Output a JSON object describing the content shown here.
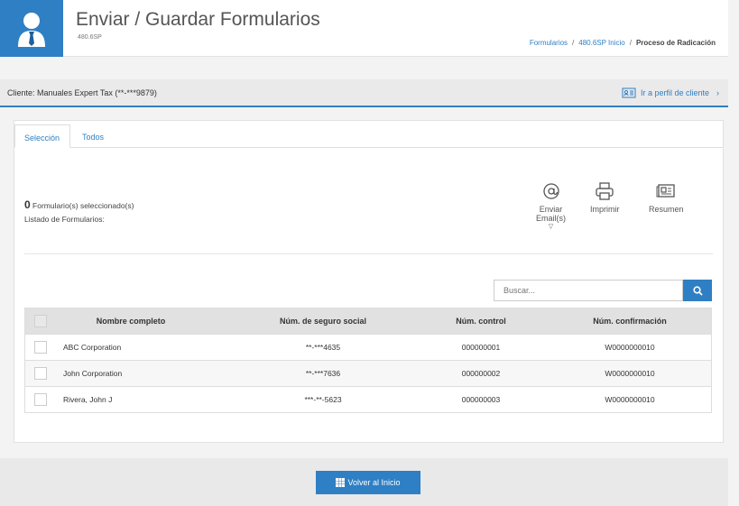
{
  "header": {
    "title": "Enviar / Guardar Formularios",
    "subtitle": "480.6SP",
    "breadcrumb": {
      "item1": "Formularios",
      "sep": "/",
      "item2": "480.6SP Inicio",
      "item3": "Proceso de Radicación"
    }
  },
  "client": {
    "label": "Cliente: Manuales Expert Tax (**-***9879)",
    "profile_link": "Ir a perfil de cliente"
  },
  "tabs": [
    {
      "label": "Selección",
      "active": true
    },
    {
      "label": "Todos",
      "active": false
    }
  ],
  "selection": {
    "count": "0",
    "count_label": " Formulario(s) seleccionado(s)",
    "list_label": "Listado de Formularios:"
  },
  "actions": {
    "email_line1": "Enviar",
    "email_line2": "Email(s)",
    "print": "Imprimir",
    "summary": "Resumen"
  },
  "search": {
    "placeholder": "Buscar..."
  },
  "table": {
    "headers": [
      "Nombre completo",
      "Núm. de seguro social",
      "Núm. control",
      "Núm. confirmación"
    ],
    "rows": [
      {
        "name": "ABC Corporation",
        "ssn": "**-***4635",
        "control": "000000001",
        "confirm": "W0000000010"
      },
      {
        "name": "John Corporation",
        "ssn": "**-***7636",
        "control": "000000002",
        "confirm": "W0000000010"
      },
      {
        "name": "Rivera, John J",
        "ssn": "***-**-5623",
        "control": "000000003",
        "confirm": "W0000000010"
      }
    ]
  },
  "footer": {
    "home_button": "Volver al Inicio"
  },
  "colors": {
    "accent": "#2f7fc4"
  }
}
